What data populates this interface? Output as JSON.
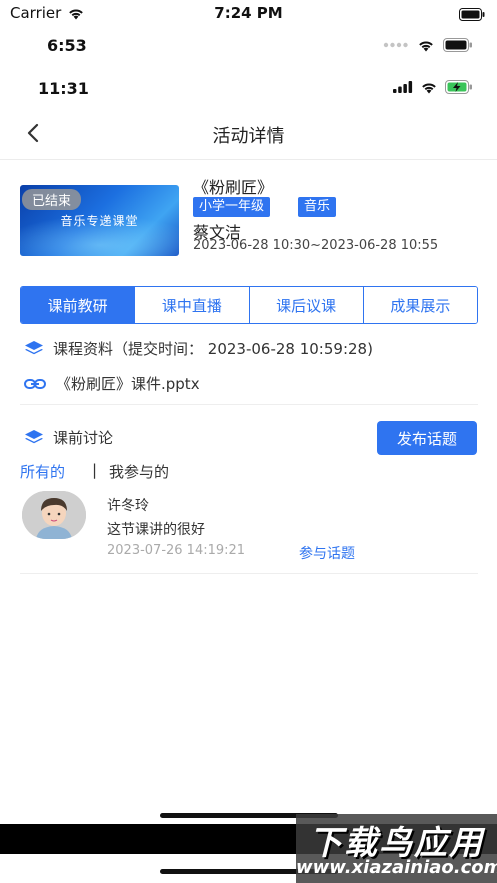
{
  "outer_status": {
    "carrier": "Carrier",
    "time": "7:24 PM"
  },
  "status_bar_1": {
    "time": "6:53"
  },
  "status_bar_2": {
    "time": "11:31"
  },
  "nav": {
    "title": "活动详情"
  },
  "activity": {
    "cover_badge": "已结束",
    "cover_text": "音乐专递课堂",
    "title": "《粉刷匠》",
    "tags": [
      "小学一年级",
      "音乐"
    ],
    "teacher": "蔡文洁",
    "time_range": "2023-06-28 10:30~2023-06-28 10:55"
  },
  "tabs": [
    {
      "label": "课前教研",
      "active": true
    },
    {
      "label": "课中直播",
      "active": false
    },
    {
      "label": "课后议课",
      "active": false
    },
    {
      "label": "成果展示",
      "active": false
    }
  ],
  "materials": {
    "heading": "课程资料（提交时间： 2023-06-28 10:59:28)",
    "file_name": "《粉刷匠》课件.pptx"
  },
  "discussion": {
    "heading": "课前讨论",
    "publish_button": "发布话题",
    "filter_all": "所有的",
    "filter_separator": "|",
    "filter_mine": "我参与的",
    "posts": [
      {
        "author": "许冬玲",
        "content": "这节课讲的很好",
        "time": "2023-07-26 14:19:21",
        "action": "参与话题"
      }
    ]
  },
  "watermark": {
    "title": "下载鸟应用",
    "url": "www.xiazainiao.com"
  },
  "colors": {
    "accent": "#2f74f0",
    "muted": "#aaaaaa",
    "text": "#333333"
  }
}
